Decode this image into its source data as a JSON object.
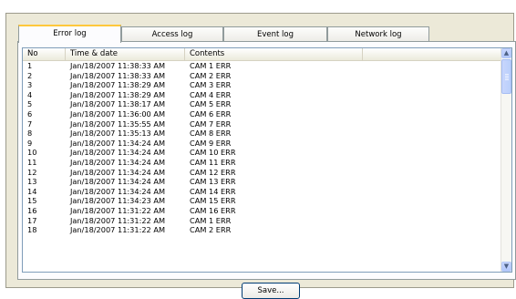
{
  "tabs": [
    {
      "label": "Error log",
      "active": true
    },
    {
      "label": "Access log",
      "active": false
    },
    {
      "label": "Event log",
      "active": false
    },
    {
      "label": "Network log",
      "active": false
    }
  ],
  "table": {
    "columns": [
      "No",
      "Time & date",
      "Contents"
    ],
    "rows": [
      [
        "1",
        "Jan/18/2007 11:38:33 AM",
        "CAM 1 ERR"
      ],
      [
        "2",
        "Jan/18/2007 11:38:33 AM",
        "CAM 2 ERR"
      ],
      [
        "3",
        "Jan/18/2007 11:38:29 AM",
        "CAM 3 ERR"
      ],
      [
        "4",
        "Jan/18/2007 11:38:29 AM",
        "CAM 4 ERR"
      ],
      [
        "5",
        "Jan/18/2007 11:38:17 AM",
        "CAM 5 ERR"
      ],
      [
        "6",
        "Jan/18/2007 11:36:00 AM",
        "CAM 6 ERR"
      ],
      [
        "7",
        "Jan/18/2007 11:35:55 AM",
        "CAM 7 ERR"
      ],
      [
        "8",
        "Jan/18/2007 11:35:13 AM",
        "CAM 8 ERR"
      ],
      [
        "9",
        "Jan/18/2007 11:34:24 AM",
        "CAM 9 ERR"
      ],
      [
        "10",
        "Jan/18/2007 11:34:24 AM",
        "CAM 10 ERR"
      ],
      [
        "11",
        "Jan/18/2007 11:34:24 AM",
        "CAM 11 ERR"
      ],
      [
        "12",
        "Jan/18/2007 11:34:24 AM",
        "CAM 12 ERR"
      ],
      [
        "13",
        "Jan/18/2007 11:34:24 AM",
        "CAM 13 ERR"
      ],
      [
        "14",
        "Jan/18/2007 11:34:24 AM",
        "CAM 14 ERR"
      ],
      [
        "15",
        "Jan/18/2007 11:34:23 AM",
        "CAM 15 ERR"
      ],
      [
        "16",
        "Jan/18/2007 11:31:22 AM",
        "CAM 16 ERR"
      ],
      [
        "17",
        "Jan/18/2007 11:31:22 AM",
        "CAM 1 ERR"
      ],
      [
        "18",
        "Jan/18/2007 11:31:22 AM",
        "CAM 2 ERR"
      ]
    ]
  },
  "scrollbar": {
    "up_icon": "arrow-up-icon",
    "down_icon": "arrow-down-icon",
    "scroll_position": 0.0
  },
  "buttons": {
    "save_label": "Save..."
  }
}
